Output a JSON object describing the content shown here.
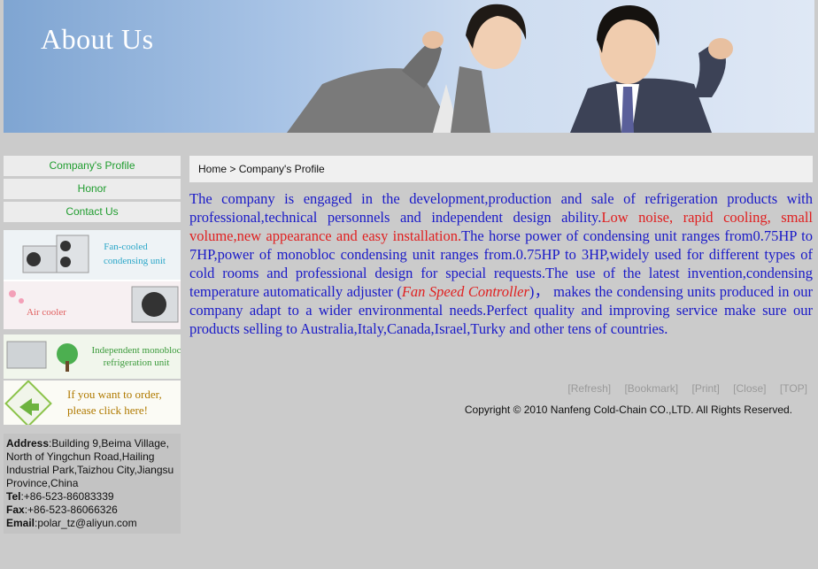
{
  "banner": {
    "title": "About Us"
  },
  "sidebar": {
    "nav": [
      "Company's Profile",
      "Honor",
      "Contact Us"
    ],
    "promos": {
      "fan_cooled": "Fan-cooled condensing unit",
      "air_cooler": "Air cooler",
      "monobloc_line1": "Independent monobloc",
      "monobloc_line2": "refrigeration unit",
      "order_line1": "If you want to order,",
      "order_line2": "please click here!"
    },
    "address": {
      "address_label": "Address",
      "address_value": "Building 9,Beima Village, North of Yingchun Road,Hailing Industrial Park,Taizhou City,Jiangsu Province,China",
      "tel_label": "Tel",
      "tel_value": "+86-523-86083339",
      "fax_label": "Fax",
      "fax_value": "+86-523-86066326",
      "email_label": "Email",
      "email_value": "polar_tz@aliyun.com"
    }
  },
  "breadcrumb": {
    "home": "Home",
    "sep": " > ",
    "current": "Company's Profile"
  },
  "content": {
    "p1": "The company is engaged in the development,production and sale of refrigeration products with professional,technical personnels and independent design ability.",
    "p2_red": "Low noise, rapid cooling, small volume,new appearance and easy installation.",
    "p3": "The horse power of condensing unit ranges from0.75HP to 7HP,power of  monobloc condensing unit ranges from.0.75HP to 3HP,widely used for different types of cold rooms and professional design for special requests.The use of the latest invention,condensing temperature automatically adjuster (",
    "p4_italic": "Fan Speed Controller",
    "p5": ")， makes the condensing units produced in our company adapt to a wider environmental needs.Perfect quality and improving service make sure our products selling to Australia,Italy,Canada,Israel,Turky and other tens of countries."
  },
  "actions": [
    "[Refresh]",
    "[Bookmark]",
    "[Print]",
    "[Close]",
    "[TOP]"
  ],
  "copyright": "Copyright © 2010 Nanfeng Cold-Chain CO.,LTD. All Rights Reserved.",
  "colors": {
    "nav_text": "#1f9c2e",
    "body_text": "#1a1ac8",
    "highlight": "#e02020"
  }
}
